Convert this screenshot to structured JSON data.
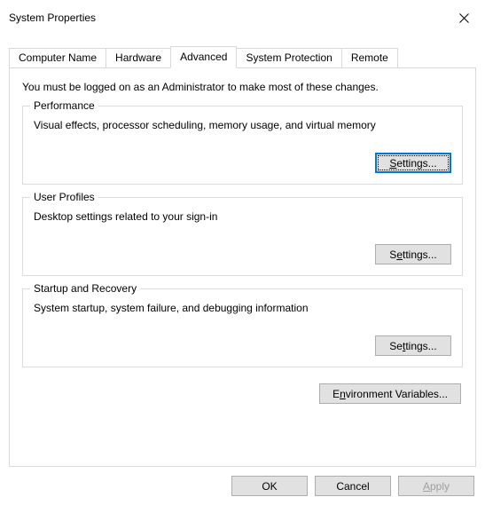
{
  "window": {
    "title": "System Properties"
  },
  "tabs": {
    "computer_name": "Computer Name",
    "hardware": "Hardware",
    "advanced": "Advanced",
    "system_protection": "System Protection",
    "remote": "Remote"
  },
  "intro_text": "You must be logged on as an Administrator to make most of these changes.",
  "groups": {
    "performance": {
      "legend": "Performance",
      "desc": "Visual effects, processor scheduling, memory usage, and virtual memory",
      "button": "Settings..."
    },
    "user_profiles": {
      "legend": "User Profiles",
      "desc": "Desktop settings related to your sign-in",
      "button": "Settings..."
    },
    "startup": {
      "legend": "Startup and Recovery",
      "desc": "System startup, system failure, and debugging information",
      "button": "Settings..."
    }
  },
  "env_button": "Environment Variables...",
  "buttons": {
    "ok": "OK",
    "cancel": "Cancel",
    "apply": "Apply"
  }
}
